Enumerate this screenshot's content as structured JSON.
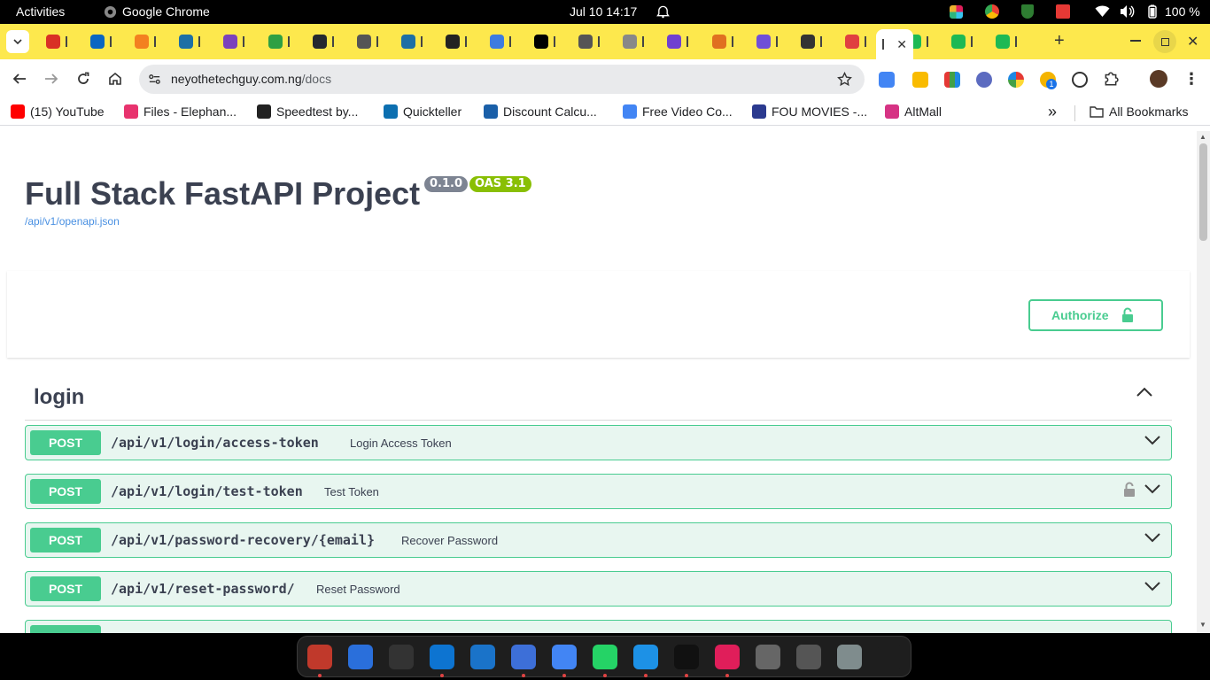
{
  "system_bar": {
    "activities": "Activities",
    "app_name": "Google Chrome",
    "datetime": "Jul 10  14:17",
    "battery": "100 %"
  },
  "browser": {
    "url_domain": "neyothetechguy.com.ng",
    "url_path": "/docs",
    "tab_colors": [
      "#d93025",
      "#0a66c2",
      "#f38020",
      "#1d6fa5",
      "#7b42bc",
      "#2ea043",
      "#24292f",
      "#555555",
      "#1d6fa5",
      "#222222",
      "#3d7be0",
      "#000000",
      "#555555",
      "#888888",
      "#7040d0",
      "#e07020",
      "#6f4fd8",
      "#333333",
      "#e04040",
      "#1db954",
      "#1db954",
      "#1db954"
    ],
    "bookmarks": [
      {
        "label": "(15) YouTube",
        "icon": "youtube-icon",
        "color": "#ff0000"
      },
      {
        "label": "Files - Elephan...",
        "icon": "files-icon",
        "color": "#e8336e"
      },
      {
        "label": "Speedtest by...",
        "icon": "speedtest-icon",
        "color": "#222222"
      },
      {
        "label": "Quickteller",
        "icon": "quickteller-icon",
        "color": "#0c6fb0"
      },
      {
        "label": "Discount Calcu...",
        "icon": "discount-icon",
        "color": "#1a5fa8"
      },
      {
        "label": "Free Video Co...",
        "icon": "google-icon",
        "color": "#4285f4"
      },
      {
        "label": "FOU MOVIES -...",
        "icon": "movies-icon",
        "color": "#2b3a8f"
      },
      {
        "label": "AltMall",
        "icon": "altmall-icon",
        "color": "#d63384"
      }
    ],
    "more_bookmarks": "»",
    "all_bookmarks": "All Bookmarks"
  },
  "page": {
    "title": "Full Stack FastAPI Project",
    "version_badge": "0.1.0",
    "oas_badge": "OAS 3.1",
    "openapi_link": "/api/v1/openapi.json",
    "authorize_label": "Authorize",
    "tag_name": "login",
    "operations": [
      {
        "method": "POST",
        "path": "/api/v1/login/access-token",
        "summary": "Login Access Token",
        "locked": false
      },
      {
        "method": "POST",
        "path": "/api/v1/login/test-token",
        "summary": "Test Token",
        "locked": true
      },
      {
        "method": "POST",
        "path": "/api/v1/password-recovery/{email}",
        "summary": "Recover Password",
        "locked": false
      },
      {
        "method": "POST",
        "path": "/api/v1/reset-password/",
        "summary": "Reset Password",
        "locked": false
      }
    ]
  },
  "colors": {
    "post_green": "#49cc90",
    "post_bg": "#e8f6f0",
    "version_badge": "#7d8492",
    "oas_badge": "#89bf04",
    "tab_bar": "#fde84d"
  },
  "dock_apps": [
    {
      "name": "files-app-icon",
      "color": "#c0392b",
      "running": true
    },
    {
      "name": "text-editor-app-icon",
      "color": "#2a6fdb",
      "running": false
    },
    {
      "name": "terminal-app-icon",
      "color": "#333333",
      "running": false
    },
    {
      "name": "vscode-app-icon",
      "color": "#0d74d1",
      "running": true
    },
    {
      "name": "system-monitor-app-icon",
      "color": "#1a73c9",
      "running": false
    },
    {
      "name": "notes-app-icon",
      "color": "#3d6fd8",
      "running": true
    },
    {
      "name": "chrome-app-icon",
      "color": "#4285f4",
      "running": true
    },
    {
      "name": "whatsapp-app-icon",
      "color": "#25d366",
      "running": true
    },
    {
      "name": "docker-app-icon",
      "color": "#1d91e6",
      "running": true
    },
    {
      "name": "anthropic-app-icon",
      "color": "#111111",
      "running": true
    },
    {
      "name": "slack-app-icon",
      "color": "#e01e5a",
      "running": true
    },
    {
      "name": "disks-app-icon",
      "color": "#666666",
      "running": false
    },
    {
      "name": "ssd-app-icon",
      "color": "#555555",
      "running": false
    },
    {
      "name": "trash-app-icon",
      "color": "#7f8c8d",
      "running": false
    },
    {
      "name": "app-grid-icon",
      "color": "#1e1e1e",
      "running": false
    }
  ]
}
